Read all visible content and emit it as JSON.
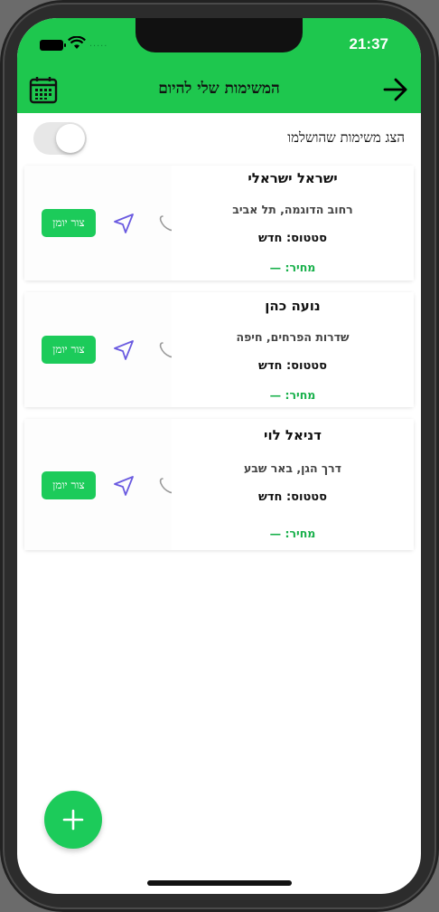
{
  "status_bar": {
    "time": "21:37",
    "signal": "....."
  },
  "header": {
    "title": "המשימות שלי להיום",
    "calendar_icon": "calendar-icon",
    "back_icon": "arrow-right-icon"
  },
  "filter": {
    "label": "הצג משימות שהושלמו",
    "enabled": false
  },
  "tasks": [
    {
      "name": "ישראל ישראלי",
      "address": "רחוב הדוגמה, תל אביב",
      "status": "סטטוס: חדש",
      "price": "מחיר: —",
      "contact_label": "צור יומן"
    },
    {
      "name": "נועה כהן",
      "address": "שדרות הפרחים, חיפה",
      "status": "סטטוס: חדש",
      "price": "מחיר: —",
      "contact_label": "צור יומן"
    },
    {
      "name": "דניאל לוי",
      "address": "דרך הגן, באר שבע",
      "status": "סטטוס: חדש",
      "price": "מחיר: —",
      "contact_label": "צור יומן"
    }
  ],
  "fab": {
    "icon": "plus-icon"
  },
  "colors": {
    "primary": "#1ec74e",
    "button": "#1ccb5a",
    "price": "#17b04a",
    "nav_icon": "#6a5ae0"
  }
}
